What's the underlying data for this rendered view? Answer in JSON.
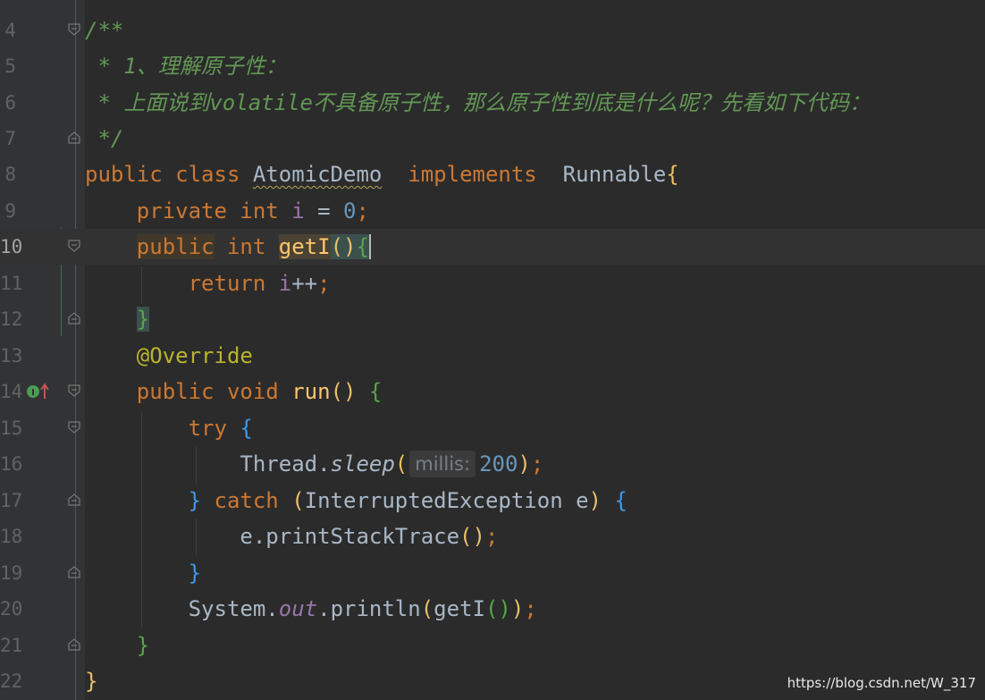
{
  "editor": {
    "colors": {
      "background": "#2b2b2b",
      "gutter": "#313335",
      "keyword": "#cc7832",
      "comment": "#629755",
      "number": "#6897bb",
      "field": "#9876aa",
      "function": "#ffc66d",
      "annotation": "#bbb529"
    },
    "line_numbers": [
      "4",
      "5",
      "6",
      "7",
      "8",
      "9",
      "10",
      "11",
      "12",
      "13",
      "14",
      "15",
      "16",
      "17",
      "18",
      "19",
      "20",
      "21",
      "22"
    ],
    "gutter_icons": {
      "line_14": "implements-method-icon"
    },
    "tokens": {
      "l4_comment_open": "/**",
      "l5_comment": " * 1、理解原子性：",
      "l6_comment": " * 上面说到volatile不具备原子性，那么原子性到底是什么呢？先看如下代码：",
      "l7_comment_close": " */",
      "public": "public",
      "class": "class",
      "AtomicDemo": "AtomicDemo",
      "implements": "implements",
      "Runnable": "Runnable",
      "open_brace": "{",
      "close_brace": "}",
      "private": "private",
      "int": "int",
      "field_i": "i",
      "assign": " = ",
      "zero": "0",
      "semicolon": ";",
      "getI": "getI",
      "open_paren": "(",
      "close_paren": ")",
      "return": "return",
      "increment": "++",
      "override": "@Override",
      "void": "void",
      "run": "run",
      "try": "try",
      "Thread": "Thread",
      "dot": ".",
      "sleep": "sleep",
      "hint_millis": "millis:",
      "two_hundred": "200",
      "catch": "catch",
      "InterruptedException": "InterruptedException",
      "var_e": "e",
      "printStackTrace": "printStackTrace",
      "System": "System",
      "out": "out",
      "println": "println"
    }
  },
  "watermark": "https://blog.csdn.net/W_317"
}
